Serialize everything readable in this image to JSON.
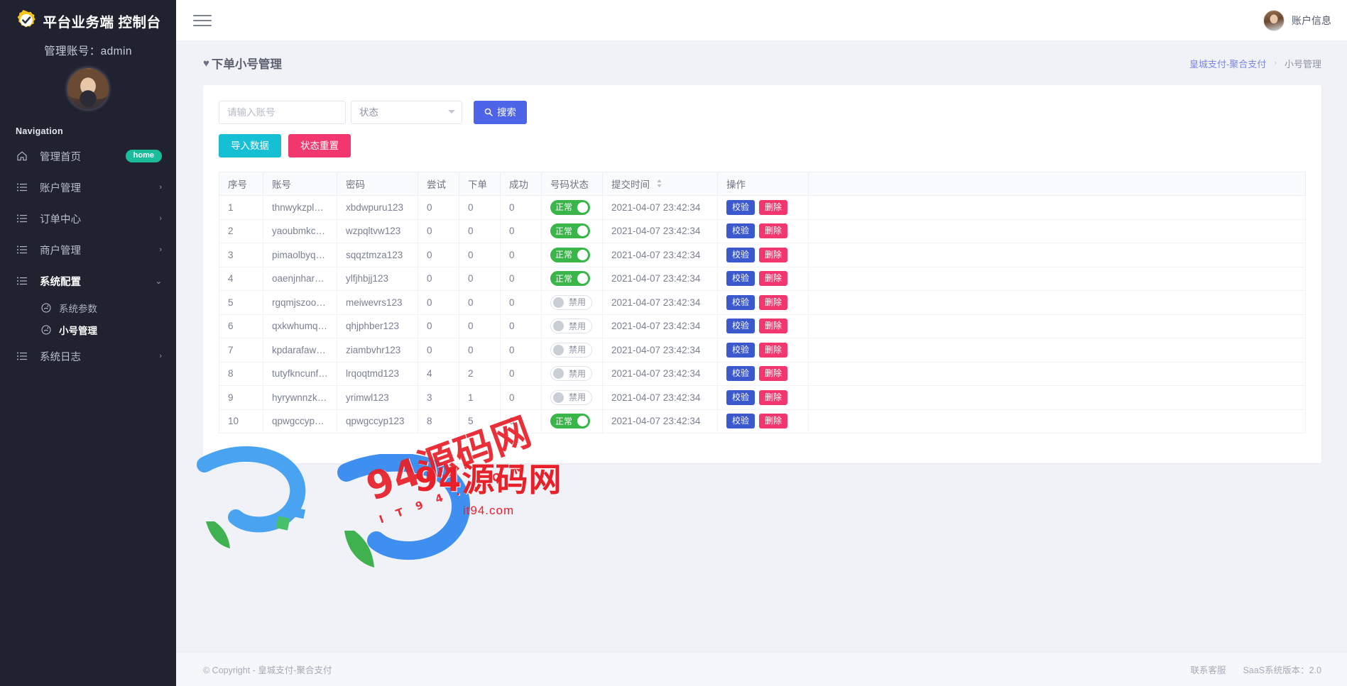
{
  "sidebar": {
    "brand_title": "平台业务端 控制台",
    "admin_line": "管理账号：admin",
    "nav_label": "Navigation",
    "items": [
      {
        "label": "管理首页",
        "icon": "home-icon",
        "badge": "home",
        "caret": ""
      },
      {
        "label": "账户管理",
        "icon": "list-icon",
        "badge": "",
        "caret": "›"
      },
      {
        "label": "订单中心",
        "icon": "list-icon",
        "badge": "",
        "caret": "›"
      },
      {
        "label": "商户管理",
        "icon": "list-icon",
        "badge": "",
        "caret": "›"
      },
      {
        "label": "系统配置",
        "icon": "list-icon",
        "badge": "",
        "caret": "⌄"
      },
      {
        "label": "系统日志",
        "icon": "list-icon",
        "badge": "",
        "caret": "›"
      }
    ],
    "submenu": [
      {
        "label": "系统参数"
      },
      {
        "label": "小号管理"
      }
    ]
  },
  "topbar": {
    "account_label": "账户信息"
  },
  "page": {
    "title": "下单小号管理",
    "heart": "♥",
    "breadcrumb_link": "皇城支付-聚合支付",
    "breadcrumb_sep": "›",
    "breadcrumb_current": "小号管理"
  },
  "filters": {
    "account_placeholder": "请输入账号",
    "account_value": "",
    "status_selected": "状态",
    "status_options": [
      "状态",
      "正常",
      "禁用"
    ],
    "search_label": "搜索",
    "search_icon": "magnifier-icon",
    "import_label": "导入数据",
    "reset_label": "状态重置"
  },
  "table": {
    "columns": [
      "序号",
      "账号",
      "密码",
      "尝试",
      "下单",
      "成功",
      "号码状态",
      "提交时间",
      "操作"
    ],
    "sort_column": "提交时间",
    "sort_icon": "▲▼",
    "action_verify": "校验",
    "action_delete": "删除",
    "status_on_label": "正常",
    "status_off_label": "禁用",
    "rows": [
      {
        "idx": "1",
        "account": "thnwykzplky…",
        "password": "xbdwpuru123",
        "try": "0",
        "order": "0",
        "success": "0",
        "status": "正常",
        "status_on": true,
        "time": "2021-04-07 23:42:34"
      },
      {
        "idx": "2",
        "account": "yaoubmkca…",
        "password": "wzpqltvw123",
        "try": "0",
        "order": "0",
        "success": "0",
        "status": "正常",
        "status_on": true,
        "time": "2021-04-07 23:42:34"
      },
      {
        "idx": "3",
        "account": "pimaolbyqz…",
        "password": "sqqztmza123",
        "try": "0",
        "order": "0",
        "success": "0",
        "status": "正常",
        "status_on": true,
        "time": "2021-04-07 23:42:34"
      },
      {
        "idx": "4",
        "account": "oaenjnharnn…",
        "password": "ylfjhbjj123",
        "try": "0",
        "order": "0",
        "success": "0",
        "status": "正常",
        "status_on": true,
        "time": "2021-04-07 23:42:34"
      },
      {
        "idx": "5",
        "account": "rgqmjszooq…",
        "password": "meiwevrs123",
        "try": "0",
        "order": "0",
        "success": "0",
        "status": "禁用",
        "status_on": false,
        "time": "2021-04-07 23:42:34"
      },
      {
        "idx": "6",
        "account": "qxkwhumqb…",
        "password": "qhjphber123",
        "try": "0",
        "order": "0",
        "success": "0",
        "status": "禁用",
        "status_on": false,
        "time": "2021-04-07 23:42:34"
      },
      {
        "idx": "7",
        "account": "kpdarafawz…",
        "password": "ziambvhr123",
        "try": "0",
        "order": "0",
        "success": "0",
        "status": "禁用",
        "status_on": false,
        "time": "2021-04-07 23:42:34"
      },
      {
        "idx": "8",
        "account": "tutyfkncunf…",
        "password": "lrqoqtmd123",
        "try": "4",
        "order": "2",
        "success": "0",
        "status": "禁用",
        "status_on": false,
        "time": "2021-04-07 23:42:34"
      },
      {
        "idx": "9",
        "account": "hyrywnnzkk…",
        "password": "yrimwl123",
        "try": "3",
        "order": "1",
        "success": "0",
        "status": "禁用",
        "status_on": false,
        "time": "2021-04-07 23:42:34"
      },
      {
        "idx": "10",
        "account": "qpwgccyp…",
        "password": "qpwgccyp123",
        "try": "8",
        "order": "5",
        "success": "0",
        "status": "正常",
        "status_on": true,
        "time": "2021-04-07 23:42:34"
      }
    ]
  },
  "watermark": {
    "top_text": "94源码网",
    "top_sub": "I T 9 4 . C O M",
    "main_text": "94源码网",
    "main_sub": "it94.com"
  },
  "footer": {
    "copyright": "© Copyright - 皇城支付-聚合支付",
    "support": "联系客服",
    "version": "SaaS系统版本：2.0"
  },
  "colors": {
    "sidebar_bg": "#20222f",
    "accent_blue": "#4d64e8",
    "cyan": "#17bfd4",
    "pink": "#f2376f",
    "green": "#39b54a",
    "badge_green": "#1abc9c"
  }
}
